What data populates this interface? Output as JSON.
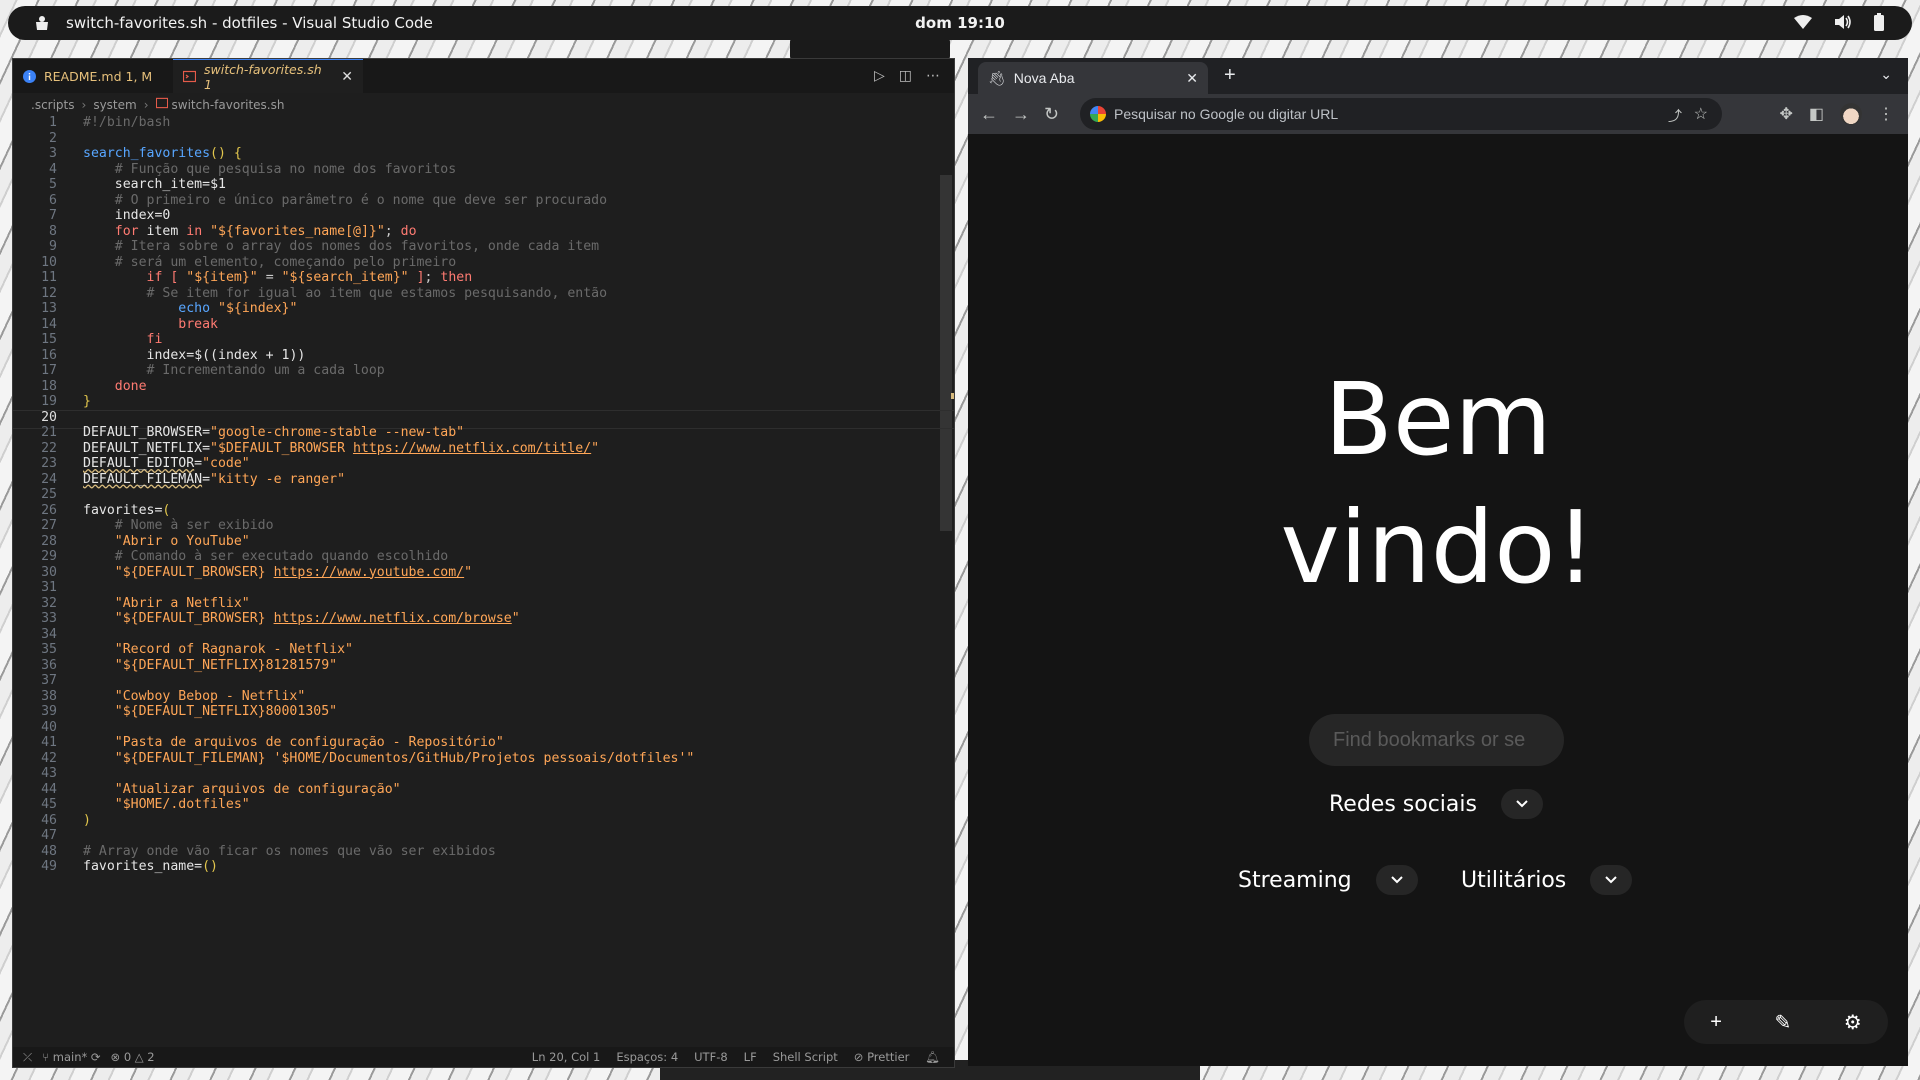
{
  "topbar": {
    "window_title": "switch-favorites.sh - dotfiles - Visual Studio Code",
    "clock": "dom 19:10",
    "tray_icons": [
      "wifi-icon",
      "volume-icon",
      "battery-icon"
    ]
  },
  "vscode": {
    "tabs": [
      {
        "label": "README.md 1, M",
        "icon": "info-icon"
      },
      {
        "label": "switch-favorites.sh 1",
        "icon": "shell-file-icon",
        "close": "✕"
      }
    ],
    "actions": [
      "run-icon",
      "split-editor-icon",
      "more-icon"
    ],
    "breadcrumb": [
      ".scripts",
      "system",
      "switch-favorites.sh"
    ],
    "lines": [
      {
        "n": "1",
        "html": "<span class='c-com'>#!/bin/bash</span>"
      },
      {
        "n": "2",
        "html": ""
      },
      {
        "n": "3",
        "html": "<span class='c-fn'>search_favorites</span><span class='c-br'>()</span> <span class='c-br'>{</span>"
      },
      {
        "n": "4",
        "html": "    <span class='c-com'># Função que pesquisa no nome dos favoritos</span>"
      },
      {
        "n": "5",
        "html": "    <span class='c-var'>search_item</span><span class='c-op'>=</span><span class='c-var'>$1</span>"
      },
      {
        "n": "6",
        "html": "    <span class='c-com'># O primeiro e único parâmetro é o nome que deve ser procurado</span>"
      },
      {
        "n": "7",
        "html": "    <span class='c-var'>index</span><span class='c-op'>=</span><span class='c-num'>0</span>"
      },
      {
        "n": "8",
        "html": "    <span class='c-kw'>for</span> <span class='c-var'>item</span> <span class='c-kw'>in</span> <span class='c-str'>\"${favorites_name[@]}\"</span>; <span class='c-kw'>do</span>"
      },
      {
        "n": "9",
        "html": "    <span class='c-com'># Itera sobre o array dos nomes dos favoritos, onde cada item</span>"
      },
      {
        "n": "10",
        "html": "    <span class='c-com'># será um elemento, começando pelo primeiro</span>"
      },
      {
        "n": "11",
        "html": "        <span class='c-kw'>if</span> <span class='c-kw'>[</span> <span class='c-str'>\"${item}\"</span> = <span class='c-str'>\"${search_item}\"</span> <span class='c-kw'>]</span>; <span class='c-kw'>then</span>"
      },
      {
        "n": "12",
        "html": "        <span class='c-com'># Se item for igual ao item que estamos pesquisando, então</span>"
      },
      {
        "n": "13",
        "html": "            <span class='c-fn'>echo</span> <span class='c-str'>\"${index}\"</span>"
      },
      {
        "n": "14",
        "html": "            <span class='c-kw'>break</span>"
      },
      {
        "n": "15",
        "html": "        <span class='c-kw'>fi</span>"
      },
      {
        "n": "16",
        "html": "        <span class='c-var'>index</span><span class='c-op'>=</span><span class='c-var'>$((index + </span><span class='c-num'>1</span><span class='c-var'>))</span>"
      },
      {
        "n": "17",
        "html": "        <span class='c-com'># Incrementando um a cada loop</span>"
      },
      {
        "n": "18",
        "html": "    <span class='c-kw'>done</span>"
      },
      {
        "n": "19",
        "html": "<span class='c-br'>}</span>"
      },
      {
        "n": "20",
        "html": "",
        "active": true
      },
      {
        "n": "21",
        "html": "<span class='c-var'>DEFAULT_BROWSER</span><span class='c-op'>=</span><span class='c-str'>\"google-chrome-stable --new-tab\"</span>"
      },
      {
        "n": "22",
        "html": "<span class='c-var'>DEFAULT_NETFLIX</span><span class='c-op'>=</span><span class='c-str'>\"$DEFAULT_BROWSER </span><span class='c-link'>https://www.netflix.com/title/</span><span class='c-str'>\"</span>"
      },
      {
        "n": "23",
        "html": "<span class='c-var' style='text-decoration:underline wavy #d7ba7d'>DEFAULT_EDITOR</span><span class='c-op'>=</span><span class='c-str'>\"code\"</span>"
      },
      {
        "n": "24",
        "html": "<span class='c-var' style='text-decoration:underline wavy #d7ba7d'>DEFAULT_FILEMAN</span><span class='c-op'>=</span><span class='c-str'>\"kitty -e ranger\"</span>"
      },
      {
        "n": "25",
        "html": ""
      },
      {
        "n": "26",
        "html": "<span class='c-var'>favorites</span><span class='c-op'>=</span><span class='c-br'>(</span>"
      },
      {
        "n": "27",
        "html": "    <span class='c-com'># Nome à ser exibido</span>"
      },
      {
        "n": "28",
        "html": "    <span class='c-str'>\"Abrir o YouTube\"</span>"
      },
      {
        "n": "29",
        "html": "    <span class='c-com'># Comando à ser executado quando escolhido</span>"
      },
      {
        "n": "30",
        "html": "    <span class='c-str'>\"${DEFAULT_BROWSER} </span><span class='c-link'>https://www.youtube.com/</span><span class='c-str'>\"</span>"
      },
      {
        "n": "31",
        "html": ""
      },
      {
        "n": "32",
        "html": "    <span class='c-str'>\"Abrir a Netflix\"</span>"
      },
      {
        "n": "33",
        "html": "    <span class='c-str'>\"${DEFAULT_BROWSER} </span><span class='c-link'>https://www.netflix.com/browse</span><span class='c-str'>\"</span>"
      },
      {
        "n": "34",
        "html": ""
      },
      {
        "n": "35",
        "html": "    <span class='c-str'>\"Record of Ragnarok - Netflix\"</span>"
      },
      {
        "n": "36",
        "html": "    <span class='c-str'>\"${DEFAULT_NETFLIX}81281579\"</span>"
      },
      {
        "n": "37",
        "html": ""
      },
      {
        "n": "38",
        "html": "    <span class='c-str'>\"Cowboy Bebop - Netflix\"</span>"
      },
      {
        "n": "39",
        "html": "    <span class='c-str'>\"${DEFAULT_NETFLIX}80001305\"</span>"
      },
      {
        "n": "40",
        "html": ""
      },
      {
        "n": "41",
        "html": "    <span class='c-str'>\"Pasta de arquivos de configuração - Repositório\"</span>"
      },
      {
        "n": "42",
        "html": "    <span class='c-str'>\"${DEFAULT_FILEMAN} '$HOME/Documentos/GitHub/Projetos pessoais/dotfiles'\"</span>"
      },
      {
        "n": "43",
        "html": ""
      },
      {
        "n": "44",
        "html": "    <span class='c-str'>\"Atualizar arquivos de configuração\"</span>"
      },
      {
        "n": "45",
        "html": "    <span class='c-str'>\"$HOME/.dotfiles\"</span>"
      },
      {
        "n": "46",
        "html": "<span class='c-br'>)</span>"
      },
      {
        "n": "47",
        "html": ""
      },
      {
        "n": "48",
        "html": "<span class='c-com'># Array onde vão ficar os nomes que vão ser exibidos</span>"
      },
      {
        "n": "49",
        "html": "<span class='c-var'>favorites_name</span><span class='c-op'>=</span><span class='c-br'>()</span>"
      }
    ],
    "status": {
      "branch": "main*",
      "problems": "⊗ 0 △ 2",
      "cursor": "Ln 20, Col 1",
      "indent": "Espaços: 4",
      "encoding": "UTF-8",
      "eol": "LF",
      "language": "Shell Script",
      "formatter": "Prettier"
    }
  },
  "chrome": {
    "tab_label": "Nova Aba",
    "omnibox_placeholder": "Pesquisar no Google ou digitar URL",
    "welcome_line1": "Bem",
    "welcome_line2": "vindo!",
    "search_placeholder": "Find bookmarks or se",
    "groups": [
      "Redes sociais",
      "Streaming",
      "Utilitários"
    ],
    "bottom_actions": [
      "add-icon",
      "edit-icon",
      "settings-icon"
    ]
  }
}
